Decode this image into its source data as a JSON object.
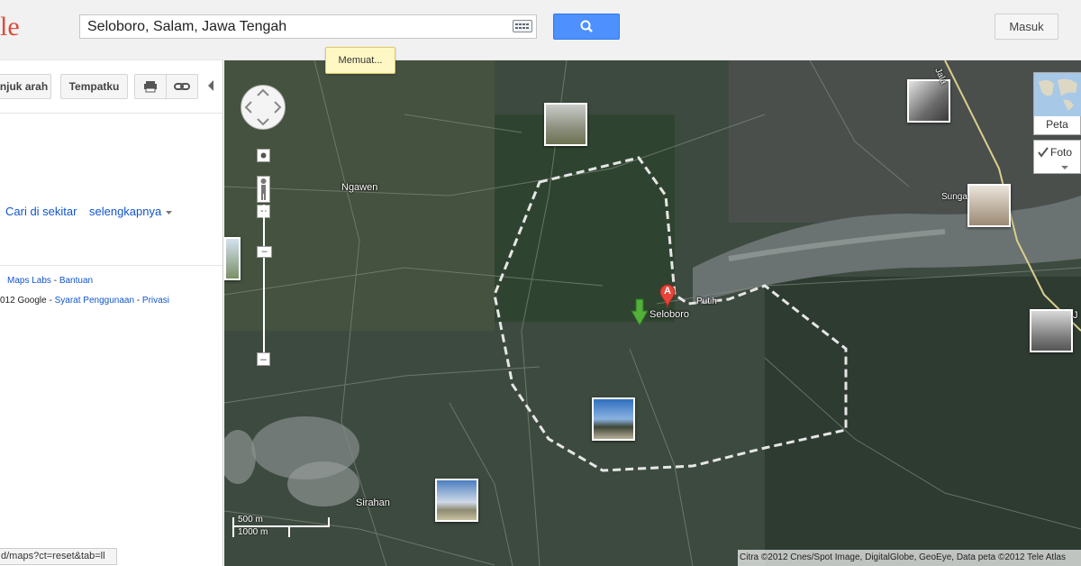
{
  "header": {
    "logo_fragment": "le",
    "search_value": "Seloboro, Salam, Jawa Tengah",
    "signin_label": "Masuk",
    "loading_label": "Memuat..."
  },
  "left_panel": {
    "directions_label": "njuk arah",
    "myplaces_label": "Tempatku",
    "search_nearby_label": "Cari di sekitar",
    "more_label": "selengkapnya",
    "footer_links": {
      "labs": "Maps Labs",
      "sep1": " - ",
      "help": "Bantuan",
      "copyright": "012 Google - ",
      "terms": "Syarat Penggunaan",
      "sep2": " - ",
      "privacy": "Privasi"
    },
    "status_url": "d/maps?ct=reset&tab=ll"
  },
  "map": {
    "labels": {
      "ngawen": "Ngawen",
      "seloboro": "Seloboro",
      "putih": "Putih",
      "sungai": "Sunga",
      "sirahan": "Sirahan",
      "jalan": "Jala",
      "j": "J"
    },
    "marker_letter": "A",
    "map_type_label": "Peta",
    "photo_label": "Foto",
    "scale": {
      "metric": "500 m",
      "imperial": "1000 m"
    },
    "attribution": "Citra ©2012 Cnes/Spot Image, DigitalGlobe, GeoEye, Data peta ©2012 Tele Atlas"
  },
  "colors": {
    "search_button": "#4d90fe",
    "marker_red": "#e8443a",
    "arrow_green": "#53b03a",
    "link_blue": "#1155cc",
    "boundary": "#e6e6e6"
  }
}
